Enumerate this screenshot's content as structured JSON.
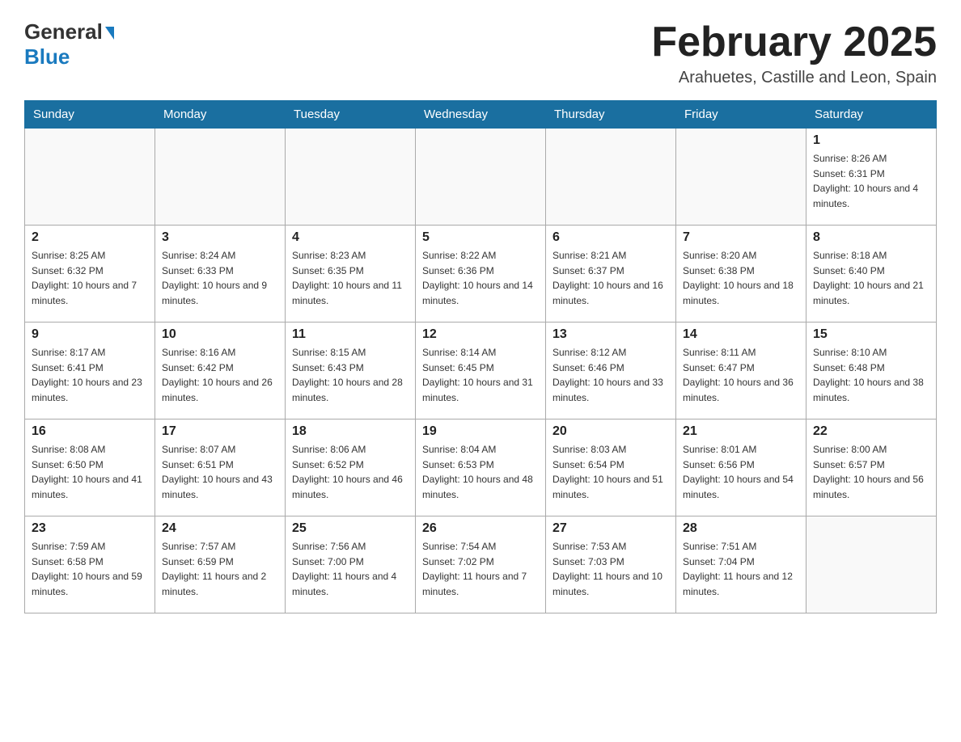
{
  "header": {
    "logo_general": "General",
    "logo_blue": "Blue",
    "month_title": "February 2025",
    "location": "Arahuetes, Castille and Leon, Spain"
  },
  "weekdays": [
    "Sunday",
    "Monday",
    "Tuesday",
    "Wednesday",
    "Thursday",
    "Friday",
    "Saturday"
  ],
  "weeks": [
    [
      {
        "day": "",
        "info": ""
      },
      {
        "day": "",
        "info": ""
      },
      {
        "day": "",
        "info": ""
      },
      {
        "day": "",
        "info": ""
      },
      {
        "day": "",
        "info": ""
      },
      {
        "day": "",
        "info": ""
      },
      {
        "day": "1",
        "info": "Sunrise: 8:26 AM\nSunset: 6:31 PM\nDaylight: 10 hours and 4 minutes."
      }
    ],
    [
      {
        "day": "2",
        "info": "Sunrise: 8:25 AM\nSunset: 6:32 PM\nDaylight: 10 hours and 7 minutes."
      },
      {
        "day": "3",
        "info": "Sunrise: 8:24 AM\nSunset: 6:33 PM\nDaylight: 10 hours and 9 minutes."
      },
      {
        "day": "4",
        "info": "Sunrise: 8:23 AM\nSunset: 6:35 PM\nDaylight: 10 hours and 11 minutes."
      },
      {
        "day": "5",
        "info": "Sunrise: 8:22 AM\nSunset: 6:36 PM\nDaylight: 10 hours and 14 minutes."
      },
      {
        "day": "6",
        "info": "Sunrise: 8:21 AM\nSunset: 6:37 PM\nDaylight: 10 hours and 16 minutes."
      },
      {
        "day": "7",
        "info": "Sunrise: 8:20 AM\nSunset: 6:38 PM\nDaylight: 10 hours and 18 minutes."
      },
      {
        "day": "8",
        "info": "Sunrise: 8:18 AM\nSunset: 6:40 PM\nDaylight: 10 hours and 21 minutes."
      }
    ],
    [
      {
        "day": "9",
        "info": "Sunrise: 8:17 AM\nSunset: 6:41 PM\nDaylight: 10 hours and 23 minutes."
      },
      {
        "day": "10",
        "info": "Sunrise: 8:16 AM\nSunset: 6:42 PM\nDaylight: 10 hours and 26 minutes."
      },
      {
        "day": "11",
        "info": "Sunrise: 8:15 AM\nSunset: 6:43 PM\nDaylight: 10 hours and 28 minutes."
      },
      {
        "day": "12",
        "info": "Sunrise: 8:14 AM\nSunset: 6:45 PM\nDaylight: 10 hours and 31 minutes."
      },
      {
        "day": "13",
        "info": "Sunrise: 8:12 AM\nSunset: 6:46 PM\nDaylight: 10 hours and 33 minutes."
      },
      {
        "day": "14",
        "info": "Sunrise: 8:11 AM\nSunset: 6:47 PM\nDaylight: 10 hours and 36 minutes."
      },
      {
        "day": "15",
        "info": "Sunrise: 8:10 AM\nSunset: 6:48 PM\nDaylight: 10 hours and 38 minutes."
      }
    ],
    [
      {
        "day": "16",
        "info": "Sunrise: 8:08 AM\nSunset: 6:50 PM\nDaylight: 10 hours and 41 minutes."
      },
      {
        "day": "17",
        "info": "Sunrise: 8:07 AM\nSunset: 6:51 PM\nDaylight: 10 hours and 43 minutes."
      },
      {
        "day": "18",
        "info": "Sunrise: 8:06 AM\nSunset: 6:52 PM\nDaylight: 10 hours and 46 minutes."
      },
      {
        "day": "19",
        "info": "Sunrise: 8:04 AM\nSunset: 6:53 PM\nDaylight: 10 hours and 48 minutes."
      },
      {
        "day": "20",
        "info": "Sunrise: 8:03 AM\nSunset: 6:54 PM\nDaylight: 10 hours and 51 minutes."
      },
      {
        "day": "21",
        "info": "Sunrise: 8:01 AM\nSunset: 6:56 PM\nDaylight: 10 hours and 54 minutes."
      },
      {
        "day": "22",
        "info": "Sunrise: 8:00 AM\nSunset: 6:57 PM\nDaylight: 10 hours and 56 minutes."
      }
    ],
    [
      {
        "day": "23",
        "info": "Sunrise: 7:59 AM\nSunset: 6:58 PM\nDaylight: 10 hours and 59 minutes."
      },
      {
        "day": "24",
        "info": "Sunrise: 7:57 AM\nSunset: 6:59 PM\nDaylight: 11 hours and 2 minutes."
      },
      {
        "day": "25",
        "info": "Sunrise: 7:56 AM\nSunset: 7:00 PM\nDaylight: 11 hours and 4 minutes."
      },
      {
        "day": "26",
        "info": "Sunrise: 7:54 AM\nSunset: 7:02 PM\nDaylight: 11 hours and 7 minutes."
      },
      {
        "day": "27",
        "info": "Sunrise: 7:53 AM\nSunset: 7:03 PM\nDaylight: 11 hours and 10 minutes."
      },
      {
        "day": "28",
        "info": "Sunrise: 7:51 AM\nSunset: 7:04 PM\nDaylight: 11 hours and 12 minutes."
      },
      {
        "day": "",
        "info": ""
      }
    ]
  ]
}
